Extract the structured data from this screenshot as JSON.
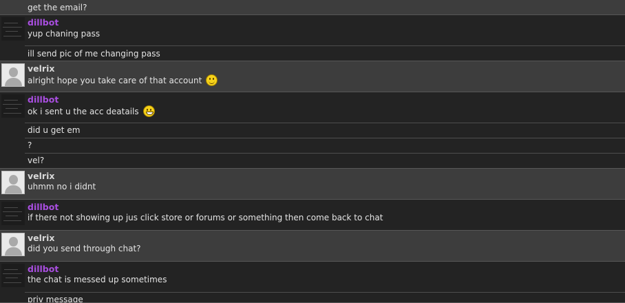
{
  "messages": [
    {
      "user": "",
      "texts": [
        "get the email?"
      ]
    },
    {
      "user": "dillbot",
      "texts": [
        "yup chaning pass",
        "ill send pic of me changing pass"
      ]
    },
    {
      "user": "velrix",
      "texts": [
        "alright hope you take care of that account"
      ],
      "emoji": "smile-emoji"
    },
    {
      "user": "dillbot",
      "texts": [
        "ok i sent u the acc deatails",
        "did u get em",
        "?",
        "vel?"
      ],
      "emoji": "grin-emoji"
    },
    {
      "user": "velrix",
      "texts": [
        "uhmm no i didnt"
      ]
    },
    {
      "user": "dillbot",
      "texts": [
        "if there not showing up jus click store or forums or something then come back to chat"
      ]
    },
    {
      "user": "velrix",
      "texts": [
        "did you send through chat?"
      ]
    },
    {
      "user": "dillbot",
      "texts": [
        "the chat is messed up sometimes",
        "priv message"
      ]
    }
  ],
  "colors": {
    "dillbot_name": "#a94ee0",
    "velrix_name": "#d8d8d8",
    "dark_bg": "#232323",
    "light_bg": "#3d3d3d"
  }
}
